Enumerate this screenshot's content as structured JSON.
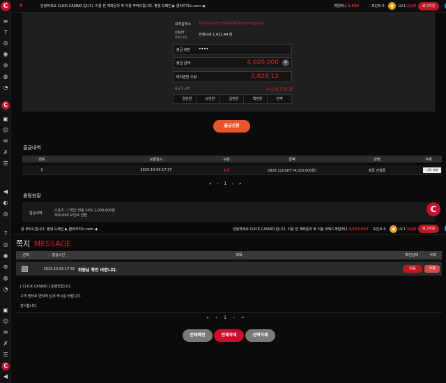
{
  "top_header": {
    "notice": "안녕하세요 CLICK CASINO 입니다. 이용 전 계좌문의 후 이용 부탁드립니다. 평생 도메인 ▶ 클릭카지노.com ◀",
    "money_label": "게임머니",
    "money_value": "3,630",
    "point_label": "포인트",
    "point_value": "0",
    "level": "LV.1",
    "user": "나님이",
    "logout": "로그아웃"
  },
  "withdraw_form": {
    "address_label": "내지갑주소",
    "address_value": "TGfXfCkw5uY3RB4SNDBHrwFWg5hWr",
    "usdt_label": "USDT",
    "usdt_sub": "(TRC-20)",
    "usdt_rate": "현재시세 1,421.44 원",
    "password_label": "출금 비번",
    "password_value": "••••",
    "amount_label": "출금 금액",
    "amount_value": "4,020,000",
    "tether_label": "테더변환 수량",
    "tether_value": "2,828.12",
    "after_label": "출금 후 금액",
    "after_value": "-4,016,370 원",
    "amount_buttons": [
      "일만원",
      "오만원",
      "십만원",
      "백만원",
      "전액"
    ],
    "submit": "출금신청"
  },
  "history": {
    "title": "출금내역",
    "columns": [
      "번호",
      "요청일시",
      "구분",
      "금액",
      "상태",
      "삭제"
    ],
    "rows": [
      {
        "no": "1",
        "date": "2025-10-09 17:37",
        "type": "출금",
        "amount": "2828.12USDT (4,020,000원)",
        "status": "출금 진행중",
        "delete": "내역 삭제"
      }
    ],
    "pager": [
      "«",
      "‹",
      "1",
      "›",
      "»"
    ]
  },
  "rolling": {
    "title": "롤링현황",
    "deposit_label": "입금내역",
    "deposit_line1": "스포츠 - (가입) 첫충 10% 1,000,000원",
    "deposit_line2": "300,000 포인트 전환"
  },
  "second_header": {
    "notice_left": "용 부탁드립니다. 평생 도메인 ▶ 클릭카지노.com ◀",
    "notice_right": "안녕하세요 CLICK CASINO 입니다. 이용 전 계좌문의 후 이용 부탁드",
    "money_label": "게임머니",
    "money_value": "4,023,630",
    "point_label": "포인트",
    "point_value": "0",
    "level": "LV.1",
    "user": "나님이",
    "logout": "로그아웃"
  },
  "message": {
    "title_ko": "쪽지",
    "title_en": "MESSAGE",
    "columns": [
      "선택",
      "발송시간",
      "제목",
      "확인상태",
      "삭제"
    ],
    "row": {
      "time": "2025.10.09 17:45",
      "subject": "회원님 확인 바랍니다.",
      "status": "읽음",
      "delete": "삭제"
    },
    "body_lines": [
      "[ CLICK CASINO ] 운영진입니다.",
      "고객 센터로 연락처 남겨 주시길 바랍니다.",
      "감사합니다."
    ],
    "pager": [
      "«",
      "‹",
      "1",
      "›",
      "»"
    ],
    "buttons": [
      "전체확인",
      "전체삭제",
      "선택삭제"
    ]
  },
  "colors": {
    "accent_red": "#d01f2a",
    "submit_orange": "#e8552a"
  }
}
